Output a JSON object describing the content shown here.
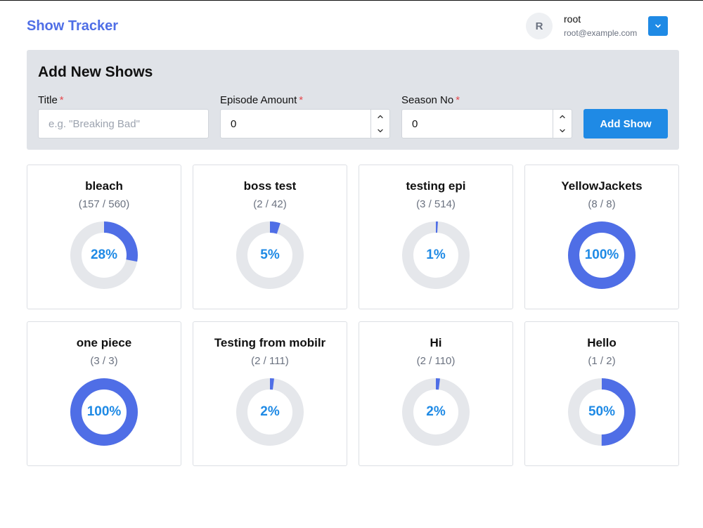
{
  "header": {
    "brand": "Show Tracker",
    "user": {
      "initial": "R",
      "name": "root",
      "email": "root@example.com"
    }
  },
  "form": {
    "title": "Add New Shows",
    "fields": [
      {
        "label": "Title",
        "required_mark": "*",
        "placeholder": "e.g. \"Breaking Bad\"",
        "value": ""
      },
      {
        "label": "Episode Amount",
        "required_mark": "*",
        "value": "0"
      },
      {
        "label": "Season No",
        "required_mark": "*",
        "value": "0"
      }
    ],
    "submit_label": "Add Show"
  },
  "colors": {
    "accent": "#1f8ae5",
    "brand": "#4f6ee6",
    "ring_fill": "#4f6ee6",
    "ring_track": "#e5e7eb",
    "panel_bg": "#e0e3e8"
  },
  "shows": [
    {
      "title": "bleach",
      "count": "(157 / 560)",
      "percent_label": "28%",
      "progress": 0.28
    },
    {
      "title": "boss test",
      "count": "(2 / 42)",
      "percent_label": "5%",
      "progress": 0.05
    },
    {
      "title": "testing epi",
      "count": "(3 / 514)",
      "percent_label": "1%",
      "progress": 0.01
    },
    {
      "title": "YellowJackets",
      "count": "(8 / 8)",
      "percent_label": "100%",
      "progress": 1.0
    },
    {
      "title": "one piece",
      "count": "(3 / 3)",
      "percent_label": "100%",
      "progress": 1.0
    },
    {
      "title": "Testing from mobilr",
      "count": "(2 / 111)",
      "percent_label": "2%",
      "progress": 0.02
    },
    {
      "title": "Hi",
      "count": "(2 / 110)",
      "percent_label": "2%",
      "progress": 0.02
    },
    {
      "title": "Hello",
      "count": "(1 / 2)",
      "percent_label": "50%",
      "progress": 0.5
    }
  ]
}
